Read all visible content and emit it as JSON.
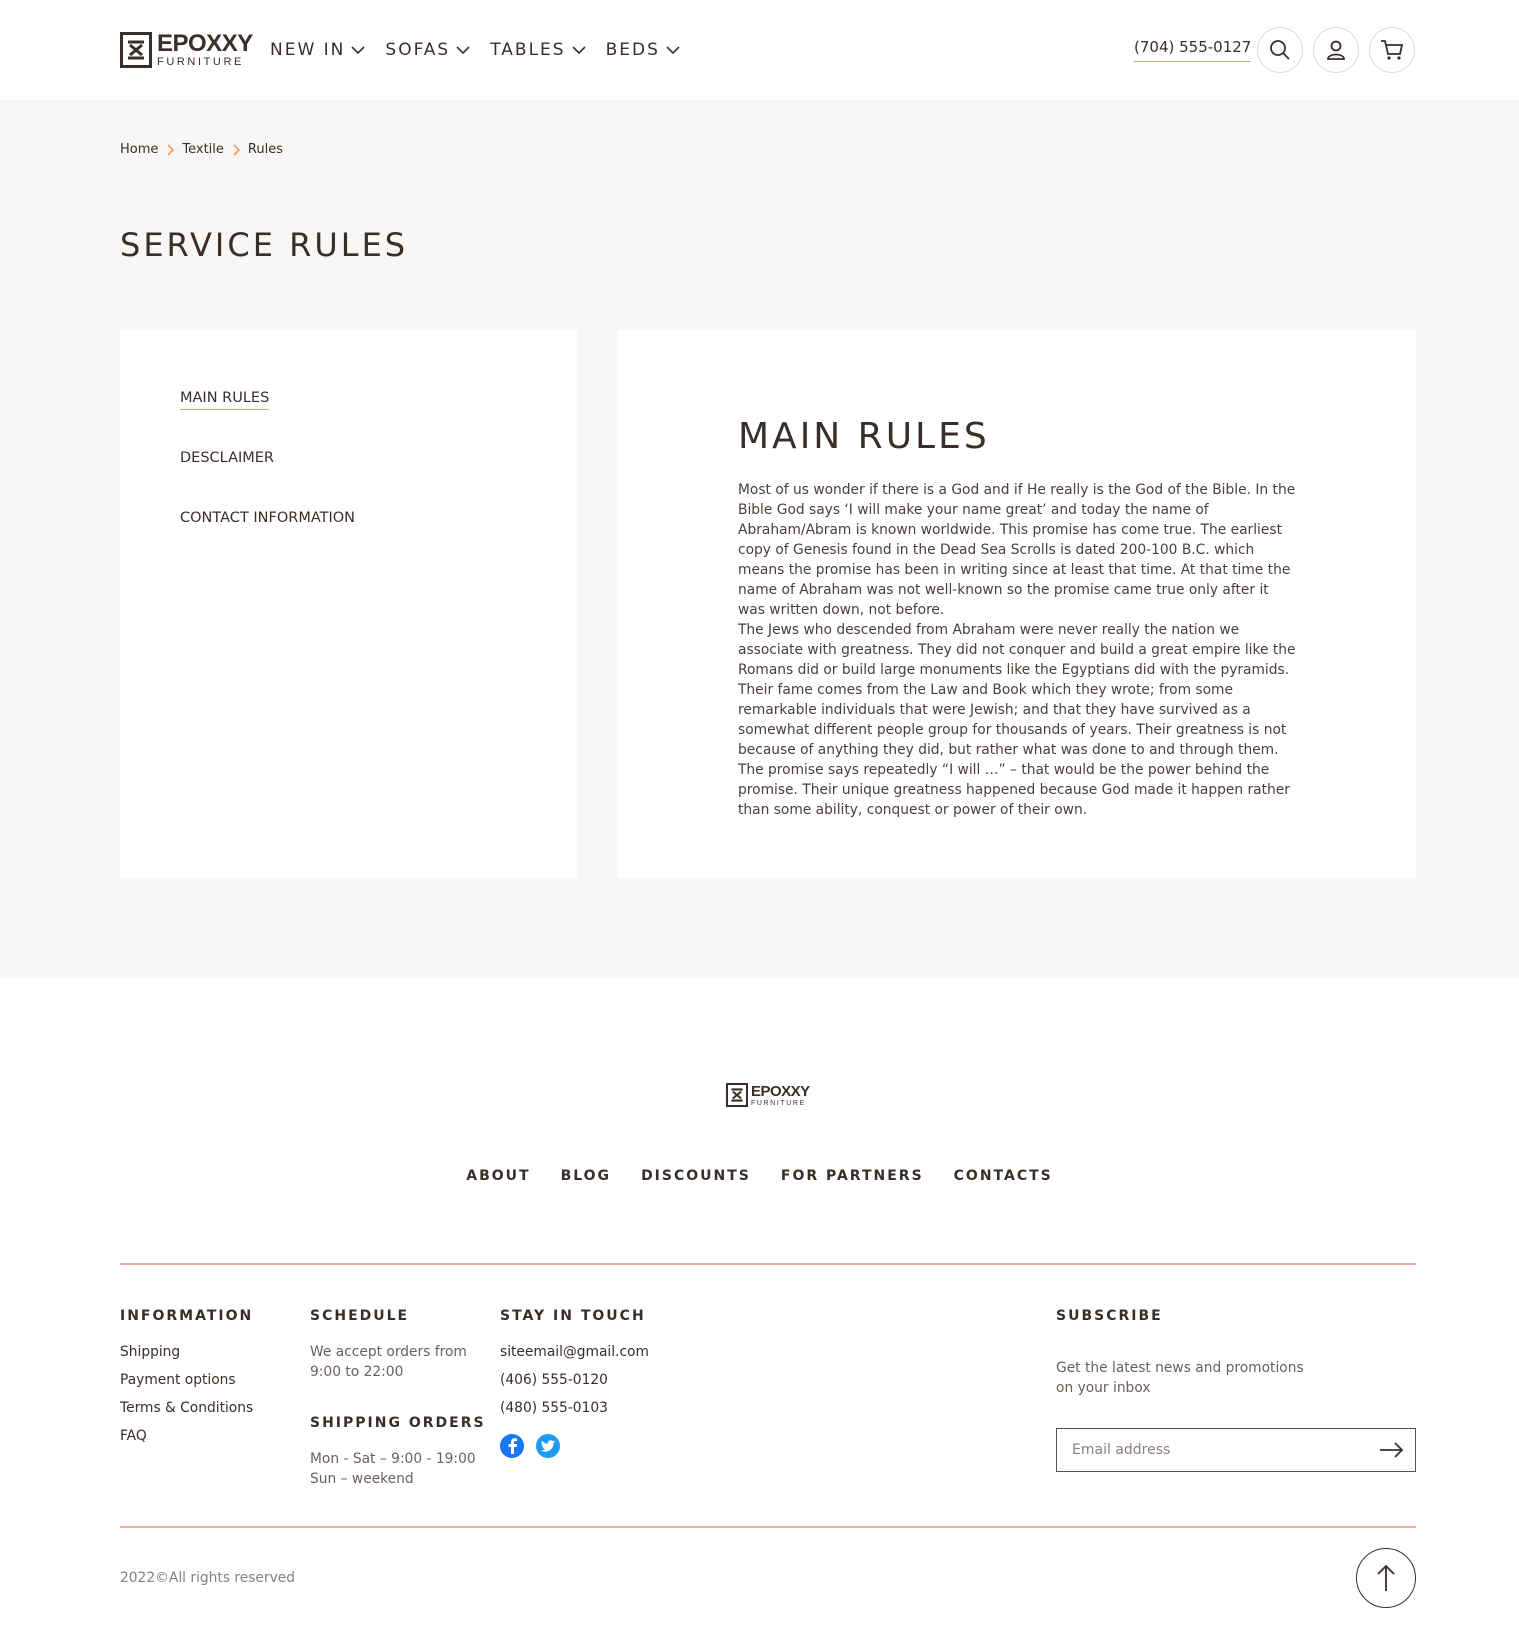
{
  "header": {
    "logo_title": "EPOXXY",
    "logo_sub": "FURNITURE",
    "nav": [
      {
        "label": "NEW IN"
      },
      {
        "label": "SOFAS"
      },
      {
        "label": "TABLES"
      },
      {
        "label": "BEDS"
      }
    ],
    "phone": "(704) 555-0127",
    "icons": [
      "search-icon",
      "user-icon",
      "cart-icon"
    ]
  },
  "breadcrumb": [
    "Home",
    "Textile",
    "Rules"
  ],
  "page_title": "SERVICE RULES",
  "sidebar": {
    "items": [
      {
        "label": "MAIN RULES",
        "active": true
      },
      {
        "label": "DESCLAIMER",
        "active": false
      },
      {
        "label": "CONTACT INFORMATION",
        "active": false
      }
    ]
  },
  "content": {
    "title": "MAIN RULES",
    "paragraphs": [
      "Most of us wonder if there is a God and if He really is the God of the Bible. In the Bible God says ‘I will make your name great’ and today the name of Abraham/Abram is known worldwide. This promise has come true. The earliest copy of Genesis found in the Dead Sea Scrolls is dated 200-100 B.C. which means the promise has been in writing since at least that time. At that time the name of Abraham was not well-known so the promise came true only after it was written down, not before.",
      "The Jews who descended from Abraham were never really the nation we associate with greatness. They did not conquer and build a great empire like the Romans did or build large monuments like the Egyptians did with the pyramids. Their fame comes from the Law and Book which they wrote; from some remarkable individuals that were Jewish; and that they have survived as a somewhat different people group for thousands of years. Their greatness is not because of anything they did, but rather what was done to and through them. The promise says repeatedly “I will …” – that would be the power behind the promise. Their unique greatness happened because God made it happen rather than some ability, conquest or power of their own."
    ]
  },
  "footer": {
    "logo_title": "EPOXXY",
    "logo_sub": "FURNITURE",
    "nav": [
      "ABOUT",
      "BLOG",
      "DISCOUNTS",
      "FOR PARTNERS",
      "CONTACTS"
    ],
    "information": {
      "title": "INFORMATION",
      "links": [
        "Shipping",
        "Payment options",
        "Terms & Conditions",
        "FAQ"
      ]
    },
    "schedule": {
      "title": "SCHEDULE",
      "line1": "We accept orders from",
      "line2": "9:00 to 22:00",
      "shipping_title": "SHIPPING ORDERS",
      "shipping_line1": "Mon - Sat – 9:00 - 19:00",
      "shipping_line2": "Sun – weekend"
    },
    "stay_in_touch": {
      "title": "STAY IN TOUCH",
      "email": "siteemail@gmail.com",
      "phone1": "(406) 555-0120",
      "phone2": "(480) 555-0103",
      "social": [
        "facebook-icon",
        "twitter-icon"
      ]
    },
    "subscribe": {
      "title": "SUBSCRIBE",
      "line1": "Get the latest news and promotions",
      "line2": "on your inbox",
      "placeholder": "Email address"
    },
    "copyright": "2022©All rights reserved"
  },
  "colors": {
    "text": "#3a2e2a",
    "accent": "#e8a06a",
    "phone_underline": "#c9a96e",
    "page_bg": "#f8f7f5",
    "facebook": "#1877f2",
    "twitter": "#1d9bf0"
  }
}
